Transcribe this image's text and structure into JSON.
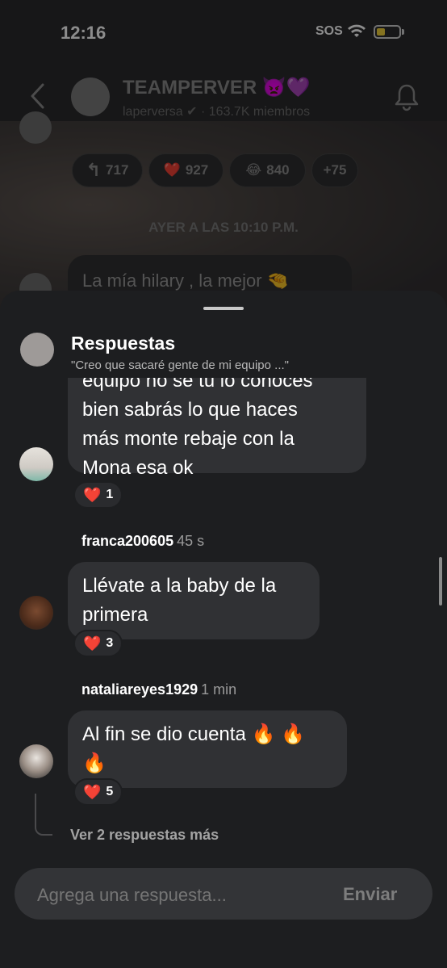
{
  "status": {
    "time": "12:16",
    "sos": "SOS"
  },
  "channel": {
    "title": "TEAMPERVER 👿💜",
    "subtitle": "laperversa ✔ · 163.7K miembros",
    "reactions": [
      {
        "emoji": "↰",
        "count": "717"
      },
      {
        "emoji": "❤️",
        "count": "927"
      },
      {
        "emoji": "😂",
        "count": "840"
      },
      {
        "emoji": "",
        "count": "+75"
      }
    ],
    "day_separator": "AYER A LAS 10:10 P.M.",
    "preview_message": "La mía hilary , la mejor 🤏"
  },
  "sheet": {
    "title": "Respuestas",
    "quote": "\"Creo que sacaré gente de mi equipo ...\"",
    "replies": [
      {
        "user": "",
        "ago": "",
        "lines": [
          "equipo no se tú lo conoces",
          "bien sabrás lo que haces",
          "más monte rebaje con la",
          "Mona esa ok"
        ],
        "heart": "❤️",
        "likes": "1"
      },
      {
        "user": "franca200605",
        "ago": "45 s",
        "lines": [
          "Llévate a la baby de la",
          "primera"
        ],
        "heart": "❤️",
        "likes": "3"
      },
      {
        "user": "nataliareyes1929",
        "ago": "1 min",
        "lines": [
          "Al fin se dio cuenta 🔥 🔥",
          "🔥"
        ],
        "heart": "❤️",
        "likes": "5"
      }
    ],
    "more_replies": "Ver 2 respuestas más"
  },
  "composer": {
    "placeholder": "Agrega una respuesta...",
    "send_label": "Enviar"
  }
}
